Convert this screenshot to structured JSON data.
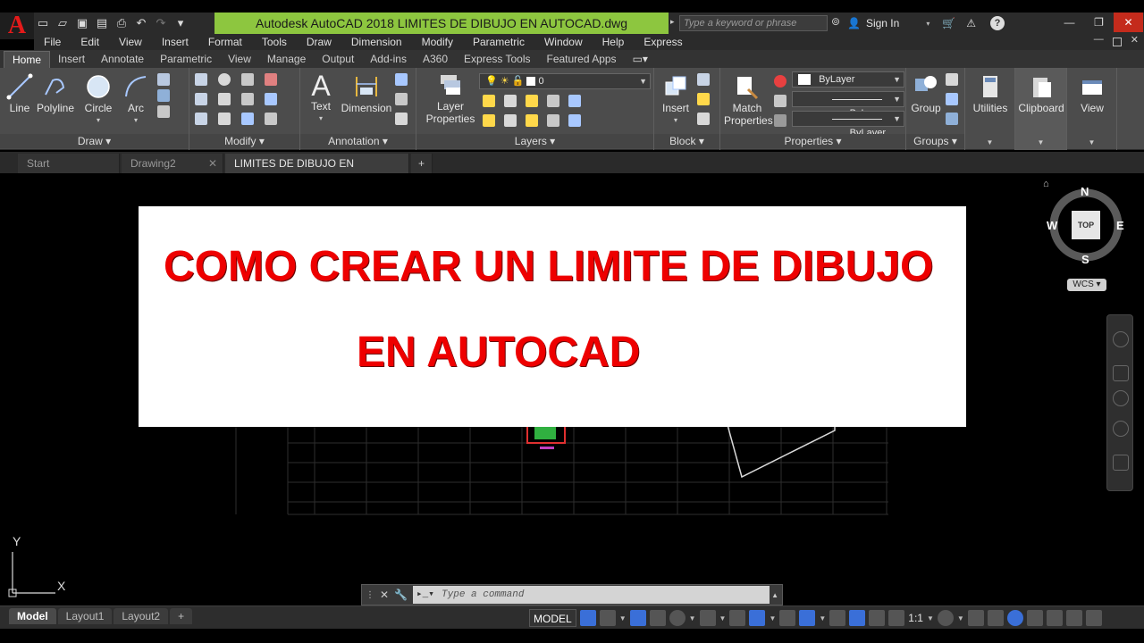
{
  "app": {
    "title": "Autodesk AutoCAD 2018    LIMITES DE DIBUJO EN AUTOCAD.dwg",
    "search_placeholder": "Type a keyword or phrase",
    "sign_in": "Sign In",
    "accent_title_bar": "#8dc63f"
  },
  "menu": [
    "File",
    "Edit",
    "View",
    "Insert",
    "Format",
    "Tools",
    "Draw",
    "Dimension",
    "Modify",
    "Parametric",
    "Window",
    "Help",
    "Express"
  ],
  "ribbon_tabs": [
    "Home",
    "Insert",
    "Annotate",
    "Parametric",
    "View",
    "Manage",
    "Output",
    "Add-ins",
    "A360",
    "Express Tools",
    "Featured Apps"
  ],
  "ribbon": {
    "draw": {
      "title": "Draw",
      "line": "Line",
      "polyline": "Polyline",
      "circle": "Circle",
      "arc": "Arc"
    },
    "modify": {
      "title": "Modify"
    },
    "annotation": {
      "title": "Annotation",
      "text": "Text",
      "dimension": "Dimension"
    },
    "layers": {
      "title": "Layers",
      "layer_properties_1": "Layer",
      "layer_properties_2": "Properties",
      "current_layer": "0"
    },
    "block": {
      "title": "Block",
      "insert": "Insert"
    },
    "properties": {
      "title": "Properties",
      "match_1": "Match",
      "match_2": "Properties",
      "color": "ByLayer",
      "linetype": "ByLayer",
      "lineweight": "ByLayer"
    },
    "groups": {
      "title": "Groups",
      "group": "Group"
    },
    "utilities": "Utilities",
    "clipboard": "Clipboard",
    "view": "View"
  },
  "file_tabs": [
    {
      "label": "Start"
    },
    {
      "label": "Drawing2"
    },
    {
      "label": "LIMITES DE DIBUJO EN AUTOCAD"
    }
  ],
  "banner": {
    "line1": "COMO CREAR UN LIMITE DE DIBUJO",
    "line2": "EN AUTOCAD",
    "text_color": "#ee0000"
  },
  "viewcube": {
    "n": "N",
    "s": "S",
    "e": "E",
    "w": "W",
    "face": "TOP",
    "wcs": "WCS"
  },
  "ucs": {
    "x": "X",
    "y": "Y"
  },
  "command": {
    "placeholder": "Type a command"
  },
  "layout_tabs": [
    "Model",
    "Layout1",
    "Layout2"
  ],
  "status": {
    "model": "MODEL",
    "scale": "1:1"
  }
}
